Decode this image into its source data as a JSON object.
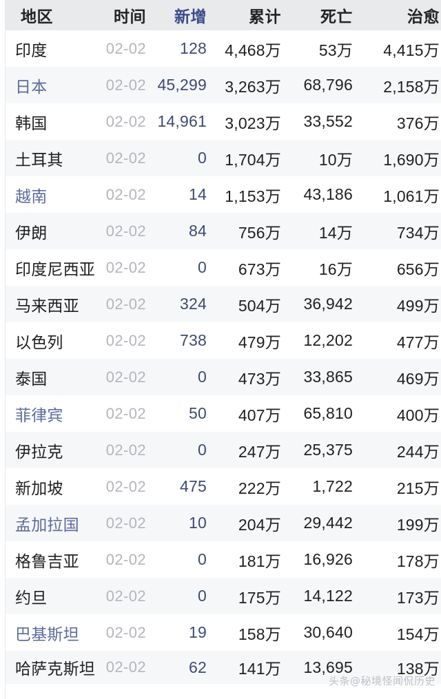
{
  "table": {
    "name": "asia-covid-statistics-table",
    "columns": [
      {
        "key": "region",
        "label": "地区",
        "align": "left",
        "accent": false
      },
      {
        "key": "date",
        "label": "时间",
        "align": "right",
        "accent": false
      },
      {
        "key": "new",
        "label": "新增",
        "align": "right",
        "accent": true
      },
      {
        "key": "total",
        "label": "累计",
        "align": "right",
        "accent": false
      },
      {
        "key": "death",
        "label": "死亡",
        "align": "right",
        "accent": false
      },
      {
        "key": "cured",
        "label": "治愈",
        "align": "right",
        "accent": false
      }
    ],
    "rows": [
      {
        "region": "印度",
        "date": "02-02",
        "new": "128",
        "total": "4,468万",
        "death": "53万",
        "cured": "4,415万",
        "tinted": false
      },
      {
        "region": "日本",
        "date": "02-02",
        "new": "45,299",
        "total": "3,263万",
        "death": "68,796",
        "cured": "2,158万",
        "tinted": true
      },
      {
        "region": "韩国",
        "date": "02-02",
        "new": "14,961",
        "total": "3,023万",
        "death": "33,552",
        "cured": "376万",
        "tinted": false
      },
      {
        "region": "土耳其",
        "date": "02-02",
        "new": "0",
        "total": "1,704万",
        "death": "10万",
        "cured": "1,690万",
        "tinted": false
      },
      {
        "region": "越南",
        "date": "02-02",
        "new": "14",
        "total": "1,153万",
        "death": "43,186",
        "cured": "1,061万",
        "tinted": true
      },
      {
        "region": "伊朗",
        "date": "02-02",
        "new": "84",
        "total": "756万",
        "death": "14万",
        "cured": "734万",
        "tinted": false
      },
      {
        "region": "印度尼西亚",
        "date": "02-02",
        "new": "0",
        "total": "673万",
        "death": "16万",
        "cured": "656万",
        "tinted": false
      },
      {
        "region": "马来西亚",
        "date": "02-02",
        "new": "324",
        "total": "504万",
        "death": "36,942",
        "cured": "499万",
        "tinted": false
      },
      {
        "region": "以色列",
        "date": "02-02",
        "new": "738",
        "total": "479万",
        "death": "12,202",
        "cured": "477万",
        "tinted": false
      },
      {
        "region": "泰国",
        "date": "02-02",
        "new": "0",
        "total": "473万",
        "death": "33,865",
        "cured": "469万",
        "tinted": false
      },
      {
        "region": "菲律宾",
        "date": "02-02",
        "new": "50",
        "total": "407万",
        "death": "65,810",
        "cured": "400万",
        "tinted": true
      },
      {
        "region": "伊拉克",
        "date": "02-02",
        "new": "0",
        "total": "247万",
        "death": "25,375",
        "cured": "244万",
        "tinted": false
      },
      {
        "region": "新加坡",
        "date": "02-02",
        "new": "475",
        "total": "222万",
        "death": "1,722",
        "cured": "215万",
        "tinted": false
      },
      {
        "region": "孟加拉国",
        "date": "02-02",
        "new": "10",
        "total": "204万",
        "death": "29,442",
        "cured": "199万",
        "tinted": true
      },
      {
        "region": "格鲁吉亚",
        "date": "02-02",
        "new": "0",
        "total": "181万",
        "death": "16,926",
        "cured": "178万",
        "tinted": false
      },
      {
        "region": "约旦",
        "date": "02-02",
        "new": "0",
        "total": "175万",
        "death": "14,122",
        "cured": "173万",
        "tinted": false
      },
      {
        "region": "巴基斯坦",
        "date": "02-02",
        "new": "19",
        "total": "158万",
        "death": "30,640",
        "cured": "154万",
        "tinted": true
      },
      {
        "region": "哈萨克斯坦",
        "date": "02-02",
        "new": "62",
        "total": "141万",
        "death": "13,695",
        "cured": "138万",
        "tinted": false
      }
    ]
  },
  "watermark": {
    "text": "头条@秘境怪闻侃历史"
  },
  "colors": {
    "header_background": "#e9eaec",
    "header_text": "#232323",
    "header_accent_text": "#3b4a86",
    "row_background_even": "#ffffff",
    "row_background_odd": "#f6f7f9",
    "body_text": "#1f1f1f",
    "date_text": "#b3b6bb",
    "new_case_text": "#3d4a74",
    "tinted_region_text": "#5d6b9b",
    "watermark_text": "#b9bcc2"
  }
}
